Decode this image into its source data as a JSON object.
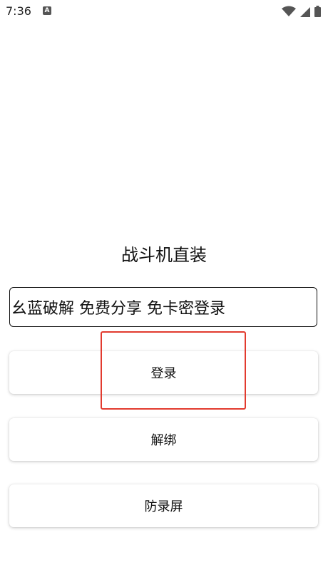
{
  "status_bar": {
    "time": "7:36",
    "notification_icon": "a-letter-icon",
    "icons": [
      "wifi-icon",
      "signal-icon",
      "battery-icon"
    ]
  },
  "main": {
    "title": "战斗机直装",
    "card_input": {
      "value": "幺蓝破解 免费分享 免卡密登录",
      "placeholder": ""
    },
    "buttons": {
      "login": "登录",
      "unbind": "解绑",
      "anti_record": "防录屏"
    }
  },
  "annotation": {
    "highlight_color": "#e23a2e"
  }
}
